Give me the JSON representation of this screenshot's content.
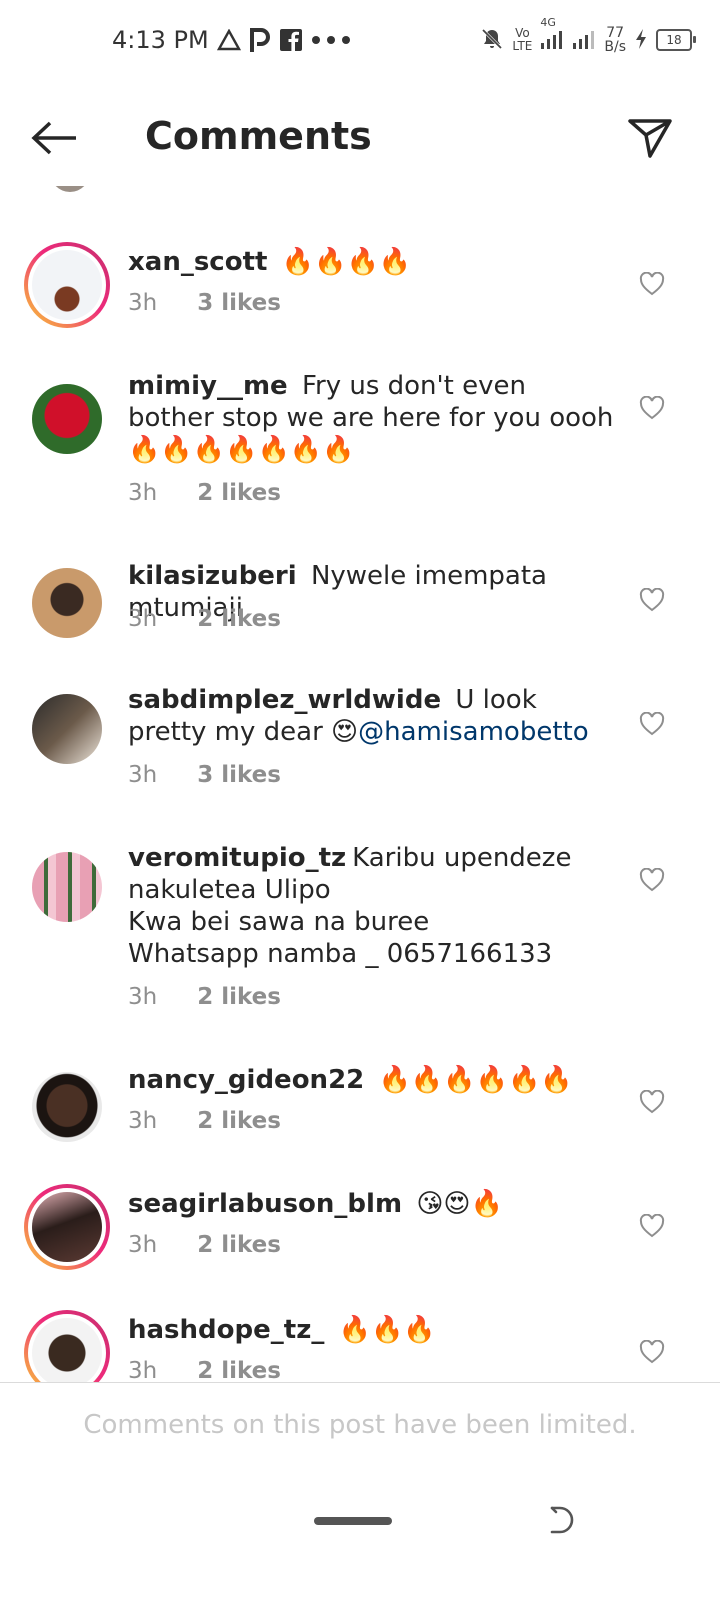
{
  "status_bar": {
    "time": "4:13 PM",
    "network_vo": "Vo",
    "network_lte": "LTE",
    "network_4g": "4G",
    "speed_value": "77",
    "speed_unit": "B/s",
    "battery": "18",
    "icons": [
      "warning-icon",
      "parking-icon",
      "facebook-icon",
      "more-dots-icon",
      "mute-icon",
      "signal-icon",
      "charging-icon",
      "battery-icon"
    ]
  },
  "header": {
    "title": "Comments",
    "back_icon": "arrow-left-icon",
    "share_icon": "send-icon"
  },
  "comments": [
    {
      "username": "xan_scott",
      "text": "",
      "emoji": "🔥🔥🔥🔥",
      "time": "3h",
      "likes": "3 likes",
      "story_ring": true
    },
    {
      "username": "mimiy__me",
      "text": "Fry us don't even bother stop we are here for you oooh ",
      "emoji": "🔥🔥🔥🔥🔥🔥🔥",
      "time": "3h",
      "likes": "2 likes",
      "story_ring": false
    },
    {
      "username": "kilasizuberi",
      "text": "Nywele imempata mtumiaji",
      "emoji": "",
      "time": "3h",
      "likes": "2 likes",
      "story_ring": false
    },
    {
      "username": "sabdimplez_wrldwide",
      "text": "U look pretty my dear ",
      "emoji": "😍",
      "mention": "@hamisamobetto",
      "time": "3h",
      "likes": "3 likes",
      "story_ring": false
    },
    {
      "username": "veromitupio_tz",
      "text_lines": [
        "Karibu upendeze nakuletea Ulipo",
        "Kwa bei sawa na buree",
        "Whatsapp namba _ 0657166133"
      ],
      "time": "3h",
      "likes": "2 likes",
      "story_ring": false
    },
    {
      "username": "nancy_gideon22",
      "text": "",
      "emoji": "🔥🔥🔥🔥🔥🔥",
      "time": "3h",
      "likes": "2 likes",
      "story_ring": false
    },
    {
      "username": "seagirlabuson_blm",
      "text": "",
      "emoji": "😘😍🔥",
      "time": "3h",
      "likes": "2 likes",
      "story_ring": true
    },
    {
      "username": "hashdope_tz_",
      "text": "",
      "emoji": "🔥🔥🔥",
      "time": "3h",
      "likes": "2 likes",
      "story_ring": true
    }
  ],
  "footer": {
    "limited_text": "Comments on this post have been limited."
  },
  "colors": {
    "text": "#262626",
    "secondary": "#8e8e8e",
    "mention": "#00376b",
    "story_ring_start": "#f9ce34",
    "story_ring_end": "#c5306e"
  }
}
